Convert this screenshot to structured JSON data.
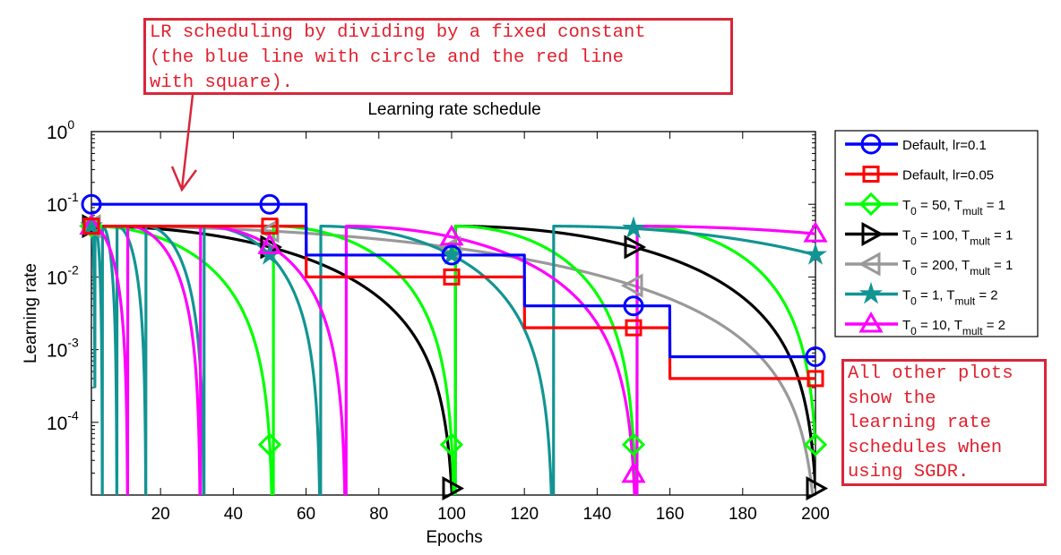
{
  "annotations": {
    "top_note": "LR scheduling by dividing by a fixed constant\n(the blue line with circle and the red line\nwith square).",
    "side_note": "All other plots\nshow the\nlearning rate\nschedules when\nusing SGDR."
  },
  "chart_data": {
    "type": "line",
    "title": "Learning rate schedule",
    "xlabel": "Epochs",
    "ylabel": "Learning rate",
    "xlim": [
      1,
      200
    ],
    "ylim": [
      1e-05,
      1
    ],
    "yscale": "log",
    "xticks": [
      20,
      40,
      60,
      80,
      100,
      120,
      140,
      160,
      180,
      200
    ],
    "yticks": [
      {
        "exp": "0",
        "value": 1
      },
      {
        "exp": "-1",
        "value": 0.1
      },
      {
        "exp": "-2",
        "value": 0.01
      },
      {
        "exp": "-3",
        "value": 0.001
      },
      {
        "exp": "-4",
        "value": 0.0001
      }
    ],
    "legend_position": "outside-right",
    "marker_epochs": [
      1,
      50,
      100,
      150,
      200
    ],
    "series": [
      {
        "name": "Default, lr=0.1",
        "label_main": "Default, lr=0.1",
        "label_sub": "",
        "label_tail": "",
        "color": "#0000ff",
        "marker": "circle",
        "kind": "step",
        "initial": 0.1,
        "drops": [
          60,
          120,
          160
        ],
        "factor": 0.2
      },
      {
        "name": "Default, lr=0.05",
        "label_main": "Default, lr=0.05",
        "label_sub": "",
        "label_tail": "",
        "color": "#ff0000",
        "marker": "square",
        "kind": "step",
        "initial": 0.05,
        "drops": [
          60,
          120,
          160
        ],
        "factor": 0.2
      },
      {
        "name": "T0 = 50, Tmult = 1",
        "label_main": "T",
        "label_sub0": "0",
        "label_mid": " = 50, T",
        "label_sub": "mult",
        "label_tail": " = 1",
        "color": "#00ff00",
        "marker": "diamond",
        "kind": "sgdr",
        "eta_max": 0.05,
        "T0": 50,
        "Tmult": 1
      },
      {
        "name": "T0 = 100, Tmult = 1",
        "label_main": "T",
        "label_sub0": "0",
        "label_mid": " = 100, T",
        "label_sub": "mult",
        "label_tail": " = 1",
        "color": "#000000",
        "marker": "triangle-right",
        "kind": "sgdr",
        "eta_max": 0.05,
        "T0": 100,
        "Tmult": 1
      },
      {
        "name": "T0 = 200, Tmult = 1",
        "label_main": "T",
        "label_sub0": "0",
        "label_mid": " = 200, T",
        "label_sub": "mult",
        "label_tail": " = 1",
        "color": "#999999",
        "marker": "triangle-left",
        "kind": "sgdr",
        "eta_max": 0.05,
        "T0": 200,
        "Tmult": 1
      },
      {
        "name": "T0 = 1, Tmult = 2",
        "label_main": "T",
        "label_sub0": "0",
        "label_mid": " = 1, T",
        "label_sub": "mult",
        "label_tail": " = 2",
        "color": "#129493",
        "marker": "star",
        "kind": "sgdr",
        "eta_max": 0.05,
        "T0": 1,
        "Tmult": 2
      },
      {
        "name": "T0 = 10, Tmult = 2",
        "label_main": "T",
        "label_sub0": "0",
        "label_mid": " = 10, T",
        "label_sub": "mult",
        "label_tail": " = 2",
        "color": "#ff00ff",
        "marker": "triangle-up",
        "kind": "sgdr",
        "eta_max": 0.05,
        "T0": 10,
        "Tmult": 2
      }
    ]
  }
}
